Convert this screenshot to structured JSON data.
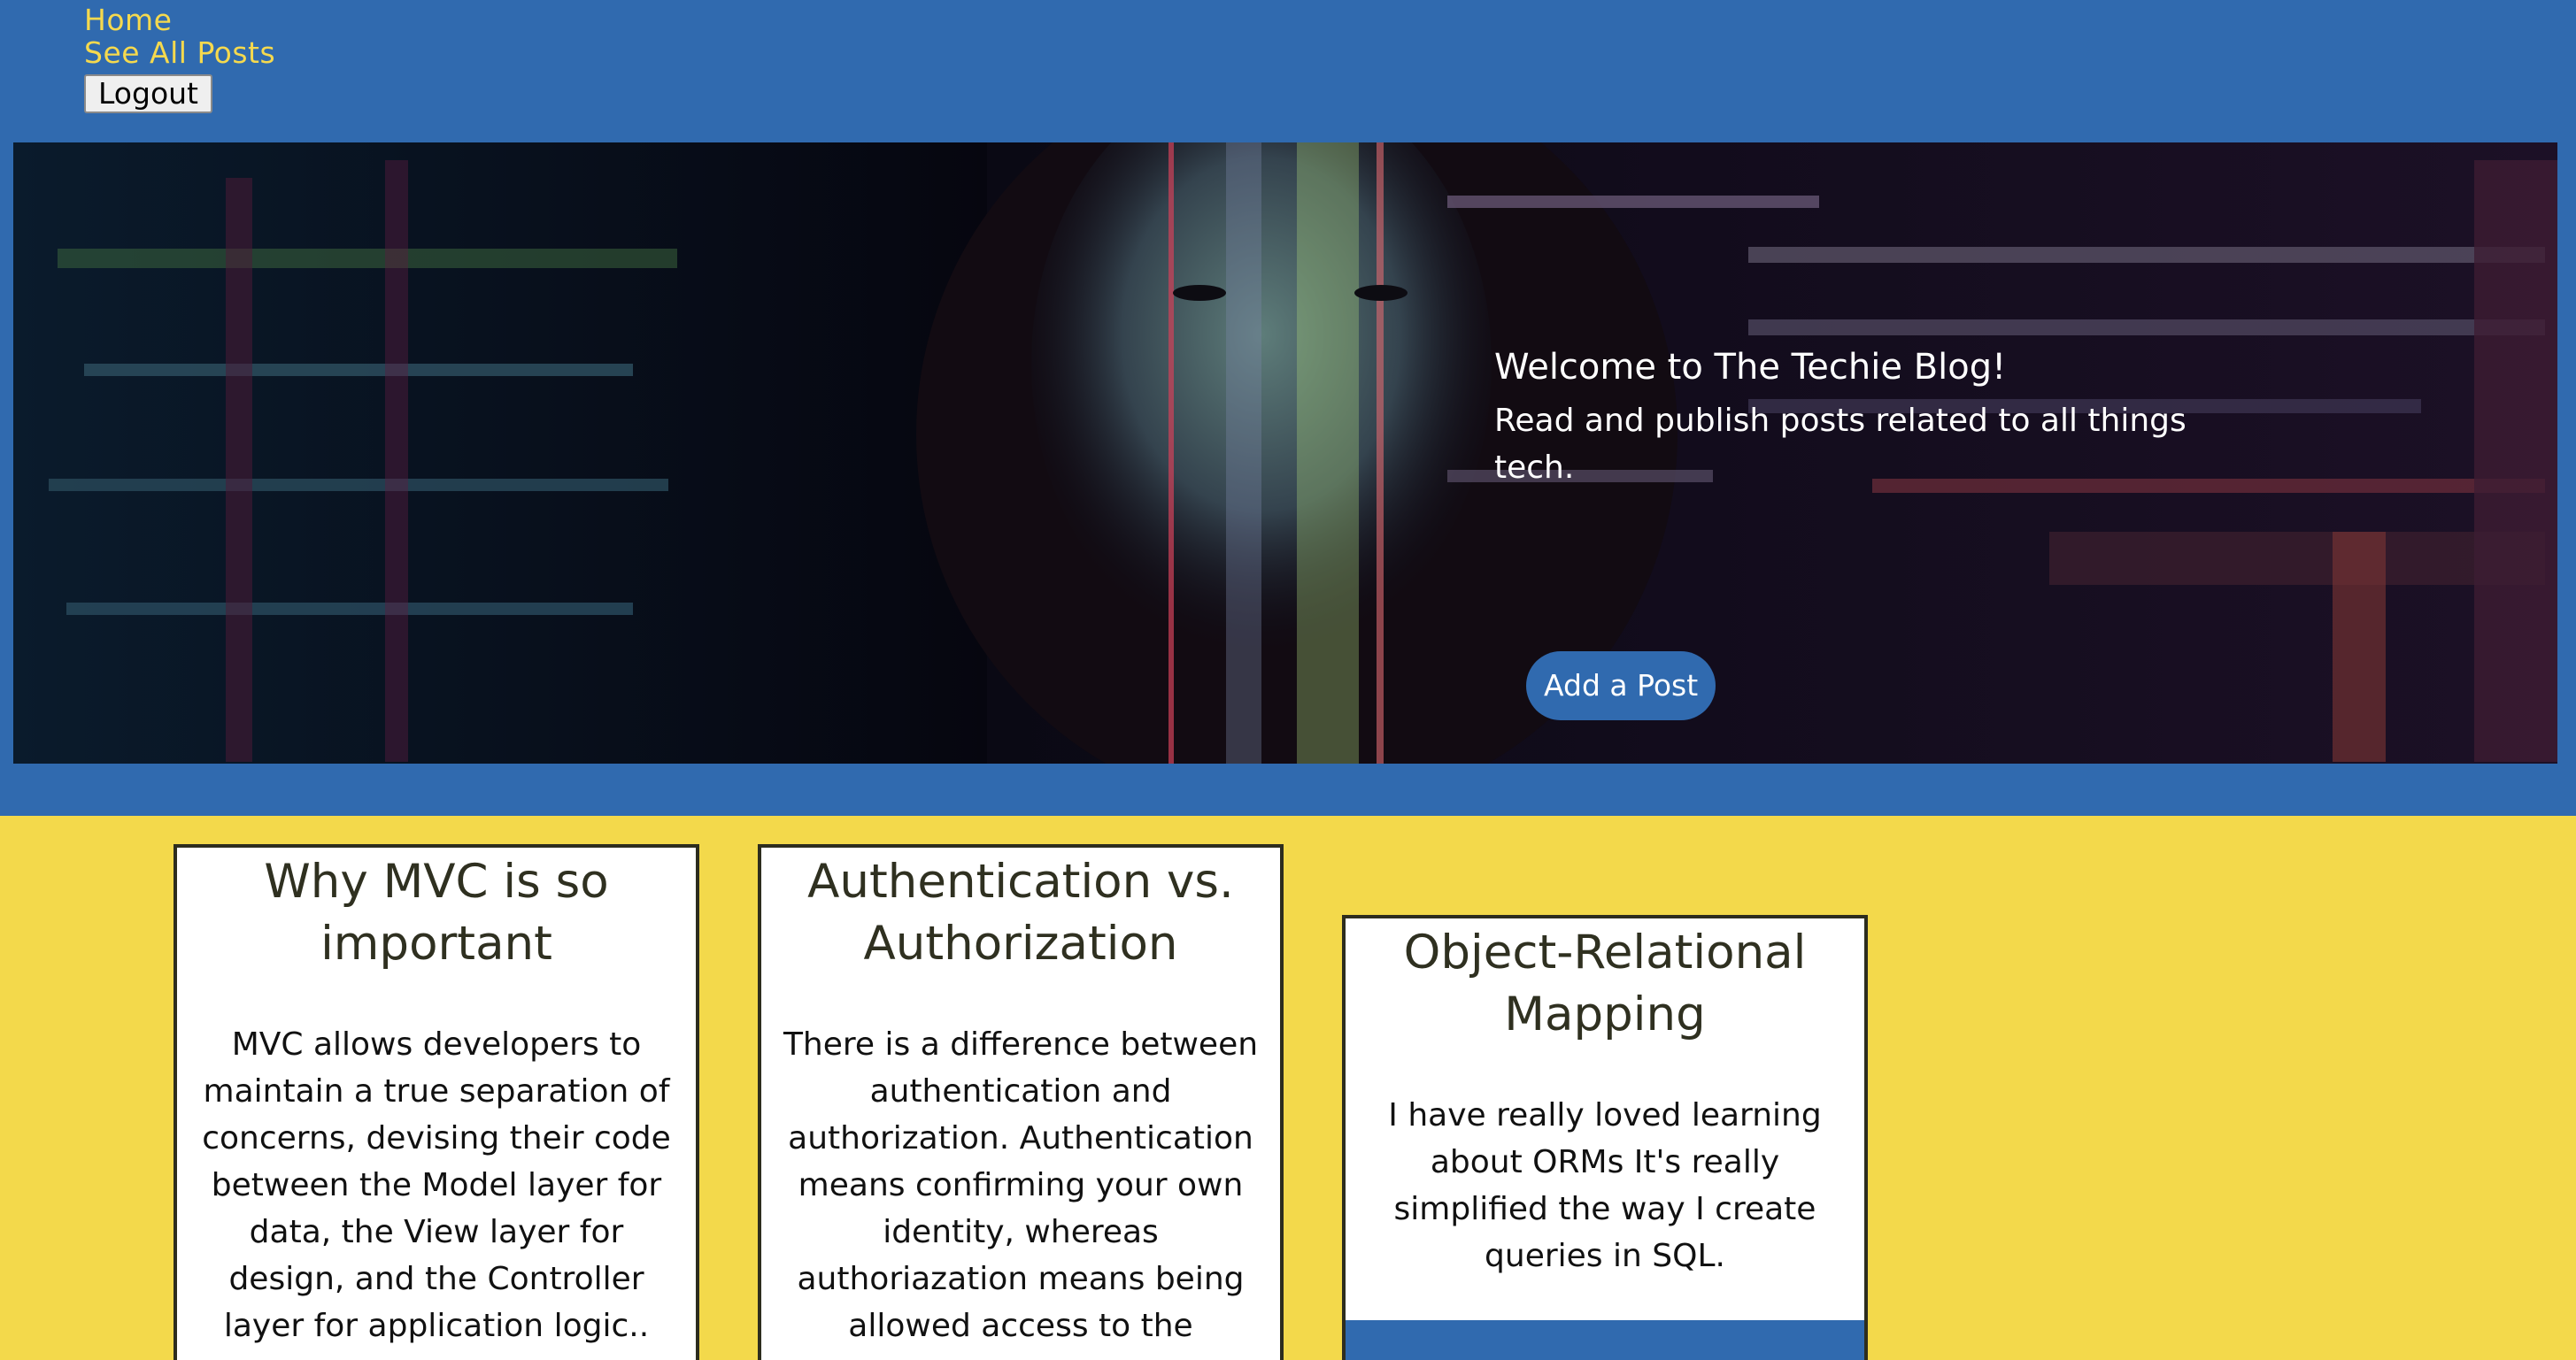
{
  "nav": {
    "home": "Home",
    "see_all_posts": "See All Posts",
    "logout": "Logout"
  },
  "hero": {
    "title": "Welcome to The Techie Blog!",
    "subtitle": "Read and publish posts related to all things tech.",
    "add_post": "Add a Post"
  },
  "posts": [
    {
      "title": "Why MVC is so important",
      "body": "MVC allows developers to maintain a true separation of concerns, devising their code between the Model layer for data, the View layer for design, and the Controller layer for application logic.."
    },
    {
      "title": "Authentication vs. Authorization",
      "body": "There is a difference between authentication and authorization. Authentication means confirming your own identity, whereas authoriazation means being allowed access to the system."
    },
    {
      "title": "Object-Relational Mapping",
      "body": "I have really loved learning about ORMs It's really simplified the way I create queries in SQL."
    }
  ],
  "colors": {
    "header_blue": "#306aaf",
    "page_yellow": "#f3d94b",
    "nav_link_yellow": "#f5d94e"
  }
}
